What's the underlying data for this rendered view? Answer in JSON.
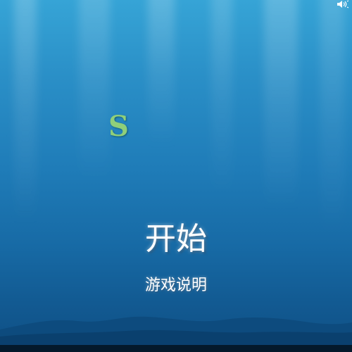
{
  "menu": {
    "logo_letter": "S",
    "start_label": "开始",
    "instructions_label": "游戏说明"
  },
  "icons": {
    "sound": "speaker-icon"
  },
  "colors": {
    "background_top": "#36a4d6",
    "background_bottom": "#0f4f84",
    "logo": "#8fcf7a",
    "menu_text": "#ffffff"
  }
}
